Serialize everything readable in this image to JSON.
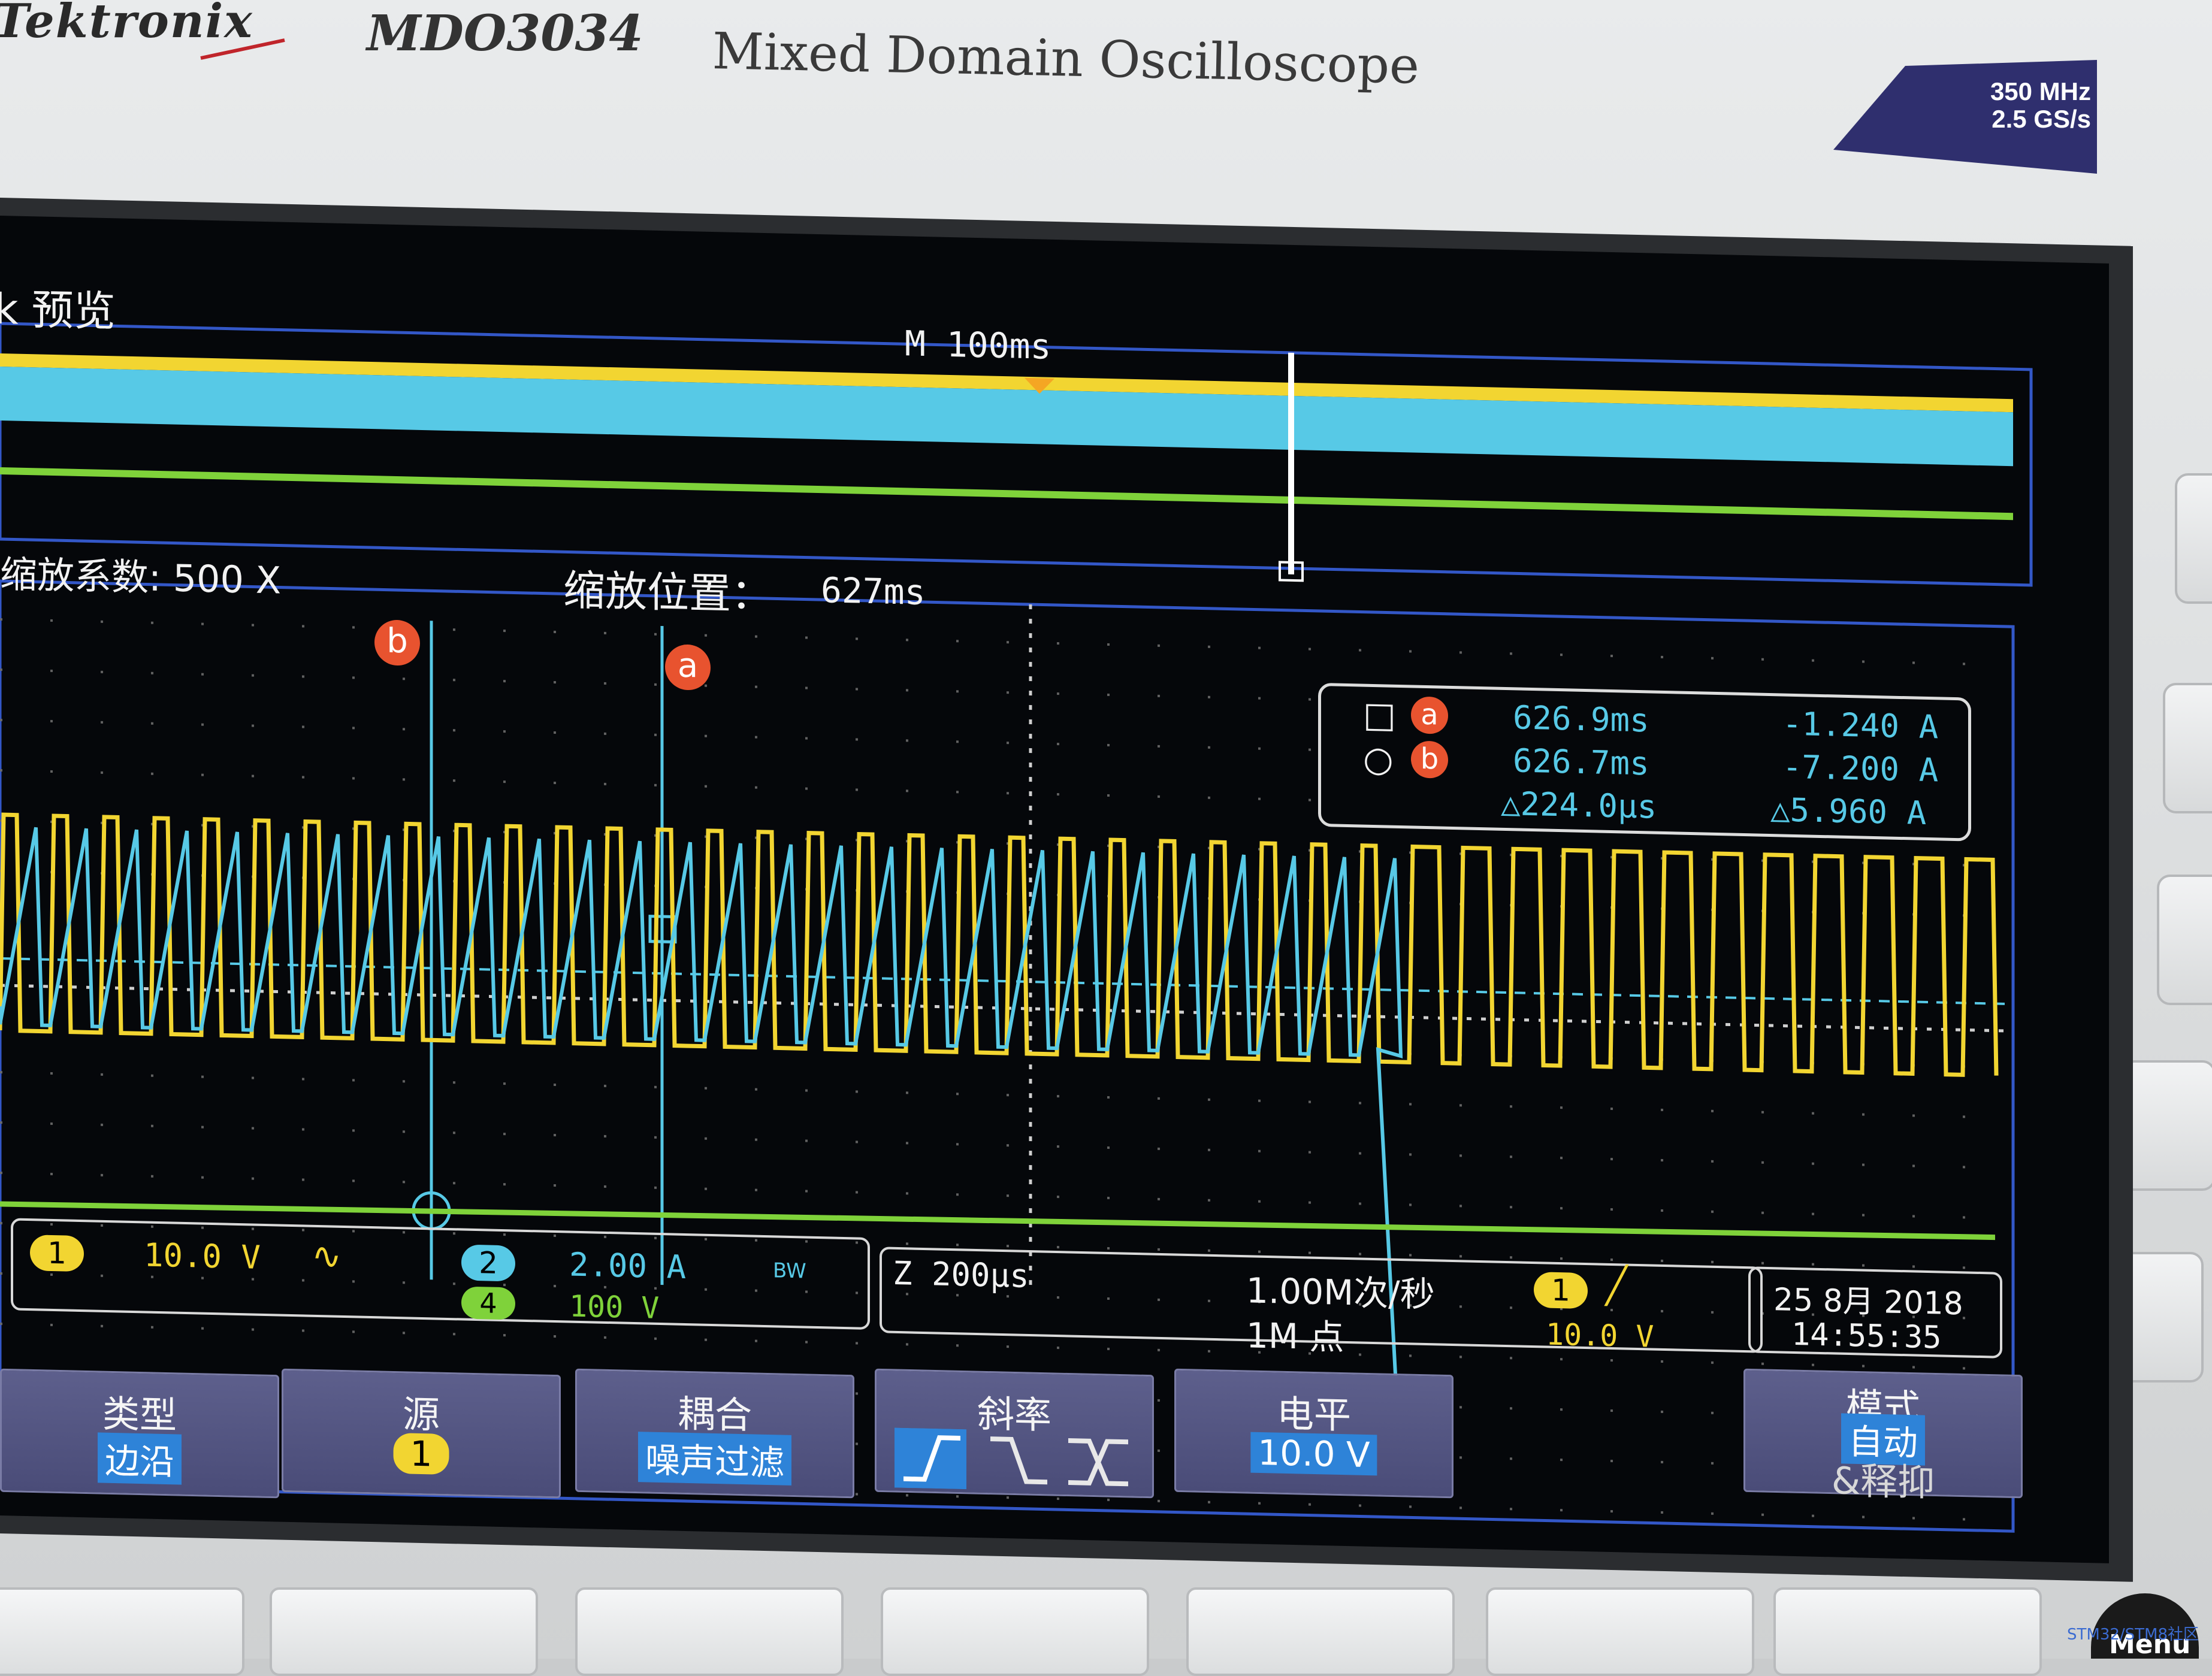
{
  "device": {
    "brand": "Tektronix",
    "model": "MDO3034",
    "subtitle": "Mixed Domain Oscilloscope",
    "spec_line1": "350 MHz",
    "spec_line2": "2.5 GS/s",
    "menu_key": "Menu",
    "watermark": "STM32/STM8社区"
  },
  "overview": {
    "title": "k 预览",
    "timebase": "M 100ms",
    "zoom_factor": "缩放系数: 500 X",
    "zoom_position_label": "缩放位置：",
    "zoom_position_value": "627ms"
  },
  "cursors": {
    "marker_a": "a",
    "marker_b": "b",
    "rows": [
      {
        "symbol": "□",
        "cursor": "a",
        "time": "626.9ms",
        "value": "-1.240 A"
      },
      {
        "symbol": "○",
        "cursor": "b",
        "time": "626.7ms",
        "value": "-7.200 A"
      },
      {
        "symbol": "",
        "cursor": "",
        "time": "△224.0μs",
        "value": "△5.960 A"
      }
    ]
  },
  "channels": {
    "ch1_num": "1",
    "ch1_scale": "10.0 V",
    "ch2_num": "2",
    "ch2_scale": "2.00 A",
    "ch2_bw": "BW",
    "ch4_num": "4",
    "ch4_scale": "100 V"
  },
  "acquisition": {
    "zoom_time": "Z 200μs",
    "sample_rate": "1.00M次/秒",
    "record_length": "1M 点",
    "trigger_ch": "1",
    "trigger_level": "10.0 V",
    "date": "25 8月 2018",
    "time": "14:55:35"
  },
  "softkeys": {
    "type_title": "类型",
    "type_value": "边沿",
    "source_title": "源",
    "source_value": "1",
    "coupling_title": "耦合",
    "coupling_value": "噪声过滤",
    "slope_title": "斜率",
    "level_title": "电平",
    "level_value": "10.0 V",
    "mode_title": "模式",
    "mode_value": "自动",
    "mode_sub": "&释抑"
  },
  "colors": {
    "ch1": "#f2d531",
    "ch2": "#57c9e6",
    "ch4": "#7fd23a",
    "cursor_marker": "#e8532f",
    "softkey_bg": "#55577f",
    "highlight": "#2e83d8"
  }
}
